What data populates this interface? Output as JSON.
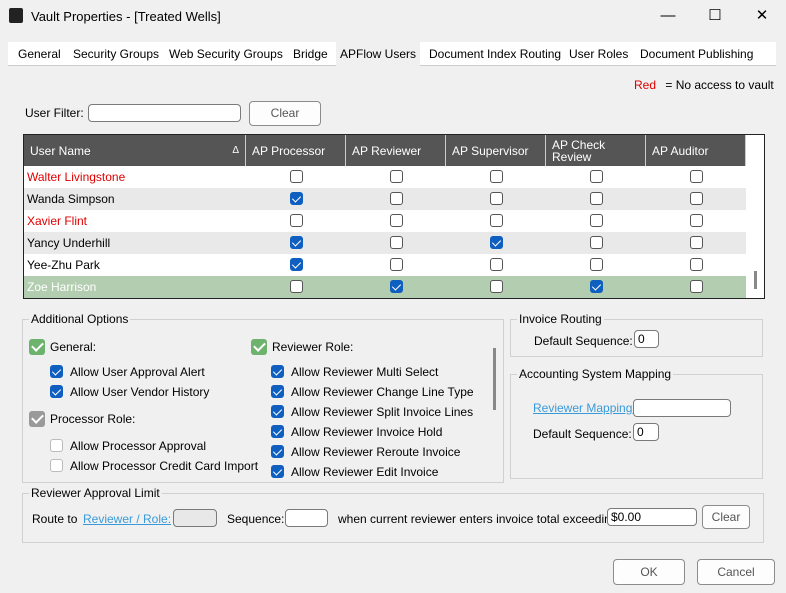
{
  "window": {
    "title": "Vault Properties - [Treated Wells]",
    "minimize": "—",
    "maximize": "☐",
    "close": "✕"
  },
  "tabs": [
    {
      "label": "General"
    },
    {
      "label": "Security Groups"
    },
    {
      "label": "Web Security Groups"
    },
    {
      "label": "Bridge"
    },
    {
      "label": "APFlow Users",
      "active": true
    },
    {
      "label": "Document Index Routing"
    },
    {
      "label": "User Roles"
    },
    {
      "label": "Document Publishing"
    }
  ],
  "legend": {
    "red": "Red",
    "text": "= No access to vault",
    "color": "#e00000"
  },
  "filter": {
    "label": "User Filter:",
    "value": "",
    "clear": "Clear"
  },
  "grid": {
    "columns": [
      "User Name",
      "AP Processor",
      "AP Reviewer",
      "AP Supervisor",
      "AP Check Review",
      "AP Auditor"
    ],
    "sort_indicator": "Δ",
    "rows": [
      {
        "name": "Walter Livingstone",
        "no_access": true,
        "checks": [
          false,
          false,
          false,
          false,
          false
        ]
      },
      {
        "name": "Wanda Simpson",
        "no_access": false,
        "checks": [
          true,
          false,
          false,
          false,
          false
        ]
      },
      {
        "name": "Xavier Flint",
        "no_access": true,
        "checks": [
          false,
          false,
          false,
          false,
          false
        ]
      },
      {
        "name": "Yancy Underhill",
        "no_access": false,
        "checks": [
          true,
          false,
          true,
          false,
          false
        ]
      },
      {
        "name": "Yee-Zhu Park",
        "no_access": false,
        "checks": [
          true,
          false,
          false,
          false,
          false
        ]
      },
      {
        "name": "Zoe Harrison",
        "no_access": false,
        "selected": true,
        "checks": [
          false,
          true,
          false,
          true,
          false
        ]
      }
    ]
  },
  "additional": {
    "title": "Additional Options",
    "general": {
      "label": "General:",
      "checked": true,
      "items": [
        {
          "label": "Allow User Approval Alert",
          "checked": true
        },
        {
          "label": "Allow User Vendor History",
          "checked": true
        }
      ]
    },
    "processor": {
      "label": "Processor Role:",
      "checked": true,
      "items": [
        {
          "label": "Allow Processor Approval",
          "checked": false
        },
        {
          "label": "Allow Processor Credit Card Import",
          "checked": false
        }
      ]
    },
    "reviewer": {
      "label": "Reviewer Role:",
      "checked": true,
      "items": [
        {
          "label": "Allow Reviewer Multi Select",
          "checked": true
        },
        {
          "label": "Allow Reviewer Change Line Type",
          "checked": true
        },
        {
          "label": "Allow Reviewer Split Invoice Lines",
          "checked": true
        },
        {
          "label": "Allow Reviewer Invoice Hold",
          "checked": true
        },
        {
          "label": "Allow Reviewer Reroute Invoice",
          "checked": true
        },
        {
          "label": "Allow Reviewer Edit Invoice",
          "checked": true
        }
      ]
    }
  },
  "invoice_routing": {
    "title": "Invoice Routing",
    "label": "Default Sequence:",
    "value": "0"
  },
  "accounting": {
    "title": "Accounting System Mapping",
    "link": "Reviewer Mapping:",
    "mapping_value": "",
    "seq_label": "Default Sequence:",
    "seq_value": "0"
  },
  "approval_limit": {
    "title": "Reviewer Approval Limit",
    "route_to": "Route to",
    "link": "Reviewer / Role:",
    "role_value": "",
    "seq_label": "Sequence:",
    "seq_value": "",
    "exceed_label": "when current reviewer enters invoice total exceeding:",
    "amount": "$0.00",
    "clear": "Clear"
  },
  "footer": {
    "ok": "OK",
    "cancel": "Cancel"
  }
}
